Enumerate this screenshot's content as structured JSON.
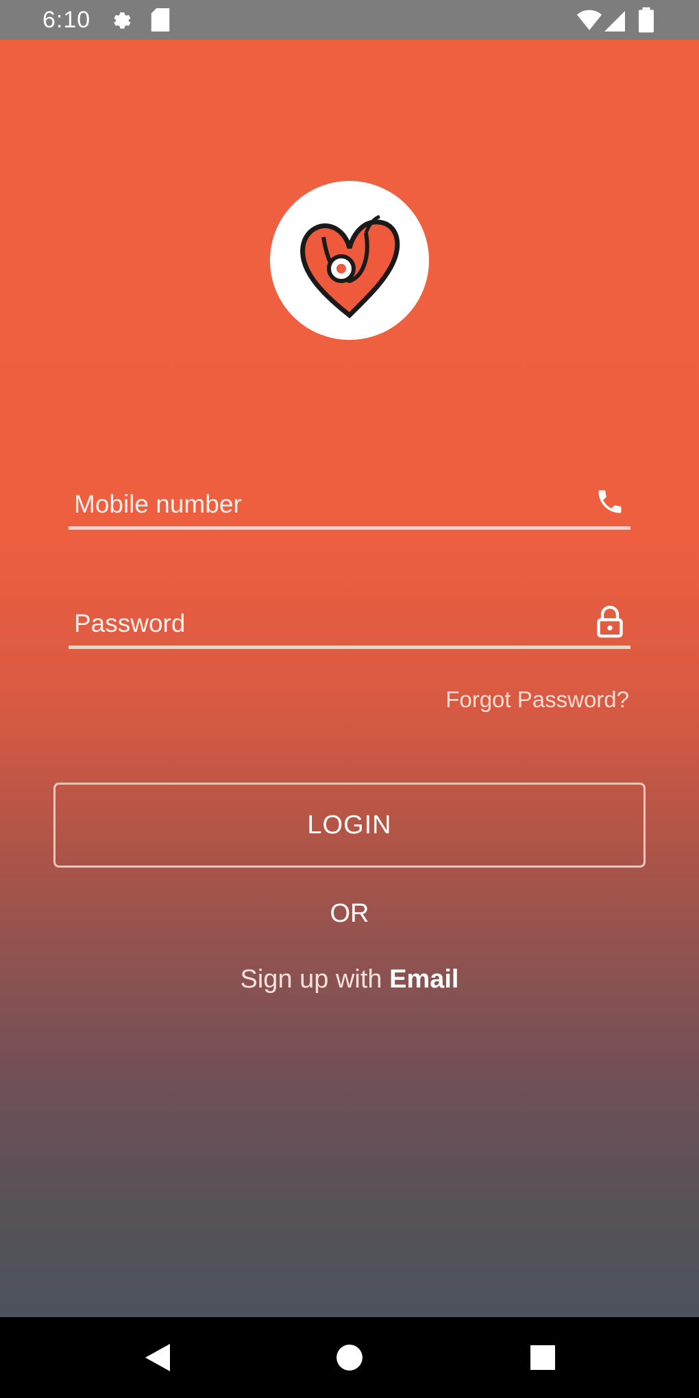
{
  "status_bar": {
    "time": "6:10",
    "icons": [
      "settings-icon",
      "sd-card-icon",
      "wifi-icon",
      "signal-icon",
      "battery-icon"
    ]
  },
  "logo": {
    "icon": "heart-stethoscope-logo",
    "colors": {
      "heart": "#ef5a3c",
      "outline": "#1a1a1a",
      "background": "#ffffff"
    }
  },
  "form": {
    "mobile": {
      "placeholder": "Mobile number",
      "value": "",
      "icon": "phone-icon"
    },
    "password": {
      "placeholder": "Password",
      "value": "",
      "icon": "lock-icon"
    },
    "forgot_password": "Forgot Password?",
    "login_button": "LOGIN",
    "or_text": "OR",
    "signup_prefix": "Sign up with ",
    "signup_link": "Email"
  },
  "nav_bar": {
    "buttons": [
      "back-icon",
      "home-icon",
      "recents-icon"
    ]
  },
  "colors": {
    "gradient_top": "#ef6040",
    "gradient_bottom": "#4c525b",
    "status_bar": "#7d7d7d"
  }
}
